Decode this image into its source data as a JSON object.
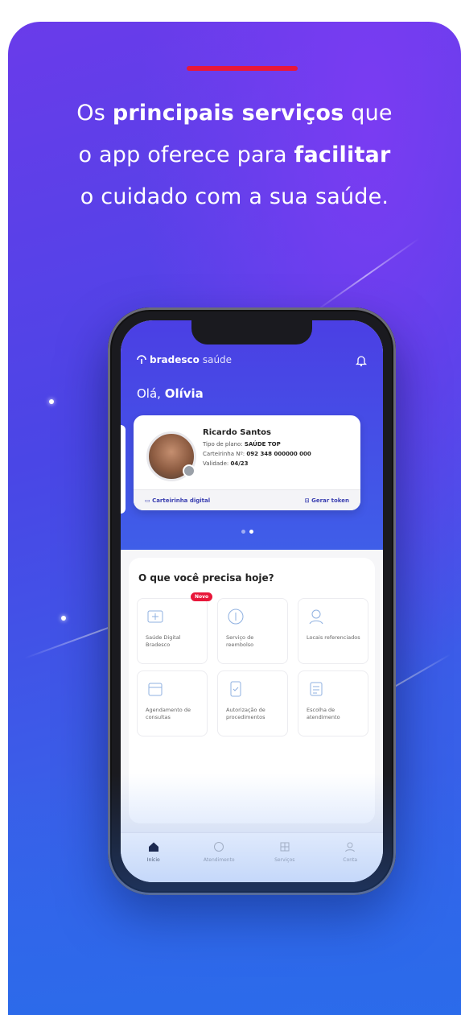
{
  "promo": {
    "headline_parts": [
      "Os ",
      "principais serviços",
      " que",
      "o app oferece para ",
      "facilitar",
      "o cuidado com a sua saúde."
    ],
    "accent_color": "#e8173a"
  },
  "app": {
    "brand": "bradesco",
    "brand_sub": "saúde",
    "greeting_prefix": "Olá,",
    "greeting_name": "Olívia",
    "member": {
      "name": "Ricardo Santos",
      "plan_label": "Tipo de plano:",
      "plan_value": "SAÚDE TOP",
      "card_label": "Carteirinha Nº:",
      "card_value": "092 348 000000 000",
      "validity_label": "Validade:",
      "validity_value": "04/23"
    },
    "card_actions": [
      "Carteirinha digital",
      "Gerar token"
    ],
    "services_title": "O que você precisa hoje?",
    "new_badge": "Novo",
    "services": [
      {
        "label": "Saúde Digital Bradesco",
        "icon": "digital-health-icon"
      },
      {
        "label": "Serviço de reembolso",
        "icon": "refund-icon"
      },
      {
        "label": "Locais referenciados",
        "icon": "locations-icon"
      },
      {
        "label": "Agendamento de consultas",
        "icon": "calendar-icon"
      },
      {
        "label": "Autorização de procedimentos",
        "icon": "authorization-icon"
      },
      {
        "label": "Escolha de atendimento",
        "icon": "care-icon"
      }
    ],
    "tabs": [
      {
        "label": "Início",
        "icon": "home-icon"
      },
      {
        "label": "Atendimento",
        "icon": "support-icon"
      },
      {
        "label": "Serviços",
        "icon": "services-icon"
      },
      {
        "label": "Conta",
        "icon": "account-icon"
      }
    ]
  }
}
